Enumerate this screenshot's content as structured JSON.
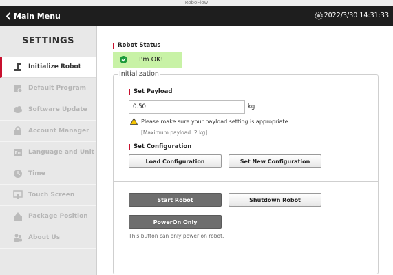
{
  "window": {
    "title": "RoboFlow"
  },
  "topbar": {
    "back_label": "Main Menu",
    "datetime": "2022/3/30 14:31:33"
  },
  "sidebar": {
    "title": "SETTINGS",
    "items": [
      {
        "label": "Initialize Robot",
        "icon": "robot-arm-icon",
        "active": true
      },
      {
        "label": "Default Program",
        "icon": "program-file-icon"
      },
      {
        "label": "Software Update",
        "icon": "cloud-upload-icon"
      },
      {
        "label": "Account Manager",
        "icon": "lock-icon"
      },
      {
        "label": "Language and Unit",
        "icon": "language-icon"
      },
      {
        "label": "Time",
        "icon": "clock-icon"
      },
      {
        "label": "Touch Screen",
        "icon": "touch-screen-icon"
      },
      {
        "label": "Package Position",
        "icon": "package-icon"
      },
      {
        "label": "About Us",
        "icon": "users-icon"
      }
    ]
  },
  "robot_status": {
    "heading": "Robot Status",
    "status_text": "I'm OK!"
  },
  "initialization": {
    "legend": "Initialization",
    "set_payload": {
      "heading": "Set Payload",
      "value": "0.50",
      "unit": "kg",
      "warning": "Please make sure your payload setting is appropriate.",
      "hint": "[Maximum payload: 2 kg]"
    },
    "set_configuration": {
      "heading": "Set Configuration",
      "load_label": "Load Configuration",
      "new_label": "Set New Configuration"
    },
    "start_label": "Start Robot",
    "shutdown_label": "Shutdown Robot",
    "poweron_label": "PowerOn Only",
    "poweron_note": "This button can only power on robot."
  },
  "colors": {
    "accent": "#c8102e",
    "status_ok_bg": "#c8f2a6",
    "topbar_bg": "#1e1e1e",
    "dark_button": "#6e6e6e"
  }
}
